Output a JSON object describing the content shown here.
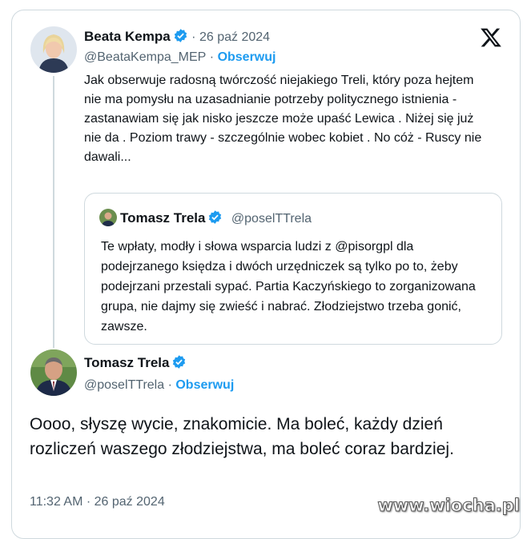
{
  "tweet1": {
    "name": "Beata Kempa",
    "date": "26 paź 2024",
    "handle": "@BeataKempa_MEP",
    "follow": "Obserwuj",
    "text": "Jak obserwuje radosną twórczość niejakiego Treli, który poza hejtem nie ma pomysłu na uzasadnianie potrzeby politycznego istnienia - zastanawiam się jak nisko jeszcze może upaść Lewica . Niżej się już nie da . Poziom trawy - szczególnie wobec kobiet . No cóż - Ruscy nie dawali..."
  },
  "quote": {
    "name": "Tomasz Trela",
    "handle": "@poselTTrela",
    "text": "Te wpłaty, modły i słowa wsparcia ludzi z @pisorgpl dla podejrzanego księdza i dwóch urzędniczek są tylko po to, żeby podejrzani przestali sypać. Partia Kaczyńskiego to zorganizowana grupa, nie dajmy się zwieść i nabrać. Złodziejstwo trzeba gonić, zawsze."
  },
  "tweet2": {
    "name": "Tomasz Trela",
    "handle": "@poselTTrela",
    "follow": "Obserwuj",
    "text": "Oooo, słyszę wycie, znakomicie. Ma boleć, każdy dzień rozliczeń waszego złodziejstwa, ma boleć coraz bardziej.",
    "timestamp": "11:32 AM · 26 paź 2024"
  },
  "watermark": "www.wiocha.pl",
  "icons": [
    "x-logo-icon",
    "verified-badge-icon"
  ],
  "colors": {
    "accent": "#1d9bf0",
    "muted": "#536471",
    "text": "#0f1419",
    "border": "#cfd9de"
  }
}
